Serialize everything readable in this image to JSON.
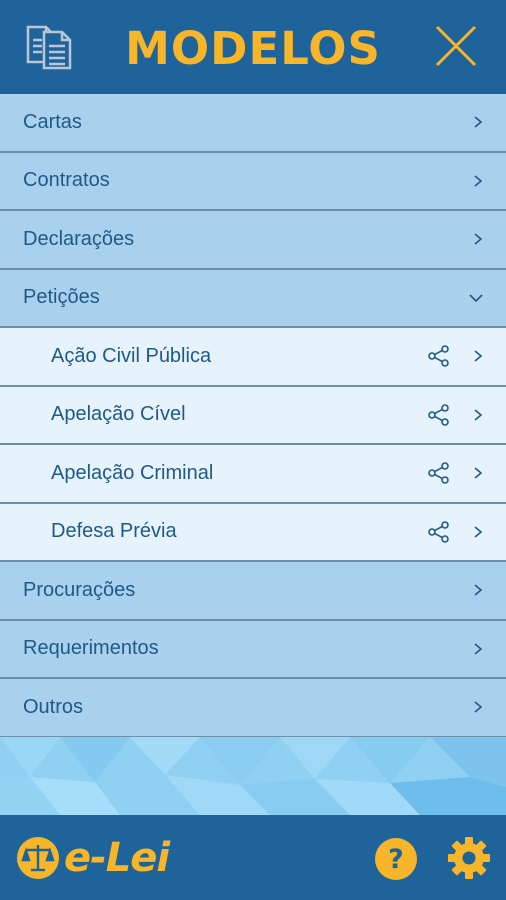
{
  "header": {
    "title": "MODELOS"
  },
  "menu": {
    "categories_top": [
      {
        "label": "Cartas",
        "expanded": false
      },
      {
        "label": "Contratos",
        "expanded": false
      },
      {
        "label": "Declarações",
        "expanded": false
      },
      {
        "label": "Petições",
        "expanded": true
      }
    ],
    "subitems": [
      {
        "label": "Ação Civil Pública"
      },
      {
        "label": "Apelação Cível"
      },
      {
        "label": "Apelação Criminal"
      },
      {
        "label": "Defesa Prévia"
      }
    ],
    "categories_bottom": [
      {
        "label": "Procurações",
        "expanded": false
      },
      {
        "label": "Requerimentos",
        "expanded": false
      },
      {
        "label": "Outros",
        "expanded": false
      }
    ]
  },
  "footer": {
    "logo_text": "e-Lei"
  },
  "colors": {
    "header_bg": "#1f639b",
    "accent_yellow": "#f7b52a",
    "category_bg": "#a9d1ee",
    "subitem_bg": "#e6f3fd",
    "text": "#1f5a86"
  },
  "icons": {
    "header_left": "document-copy-icon",
    "header_right": "close-icon",
    "row_chevron": "chevron-right-icon",
    "expanded_chevron": "chevron-down-icon",
    "share": "share-icon",
    "footer_help": "help-icon",
    "footer_settings": "gear-icon",
    "logo": "scales-icon"
  }
}
